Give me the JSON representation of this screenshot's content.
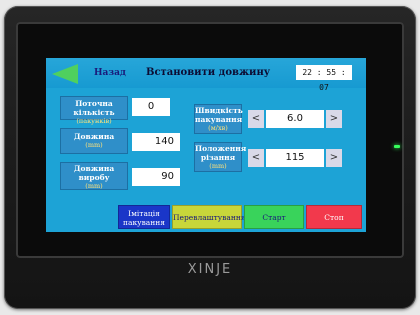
{
  "header": {
    "back_label": "Назад",
    "title": "Встановити довжину",
    "time": "22 : 55 : 07"
  },
  "fields": {
    "current_count": {
      "label": "Поточна кількість",
      "unit": "(пакунків)",
      "value": "0"
    },
    "length": {
      "label": "Довжина",
      "unit": "(mm)",
      "value": "140"
    },
    "product_length": {
      "label": "Довжина виробу",
      "unit": "(mm)",
      "value": "90"
    },
    "packing_speed": {
      "label": "Швидкість пакування",
      "unit": "(м/хв)",
      "value": "6.0",
      "dec": "<",
      "inc": ">"
    },
    "cut_position": {
      "label": "Положення різання",
      "unit": "(mm)",
      "value": "115",
      "dec": "<",
      "inc": ">"
    }
  },
  "buttons": {
    "simulate": {
      "label": "Імітація пакування",
      "color": "#1a36c8"
    },
    "reset": {
      "label": "Перевлаштування",
      "color": "#c8d63a"
    },
    "start": {
      "label": "Старт",
      "color": "#39d35b"
    },
    "stop": {
      "label": "Стоп",
      "color": "#f2394c"
    }
  },
  "device": {
    "brand": "XINJE",
    "screen_color": "#1da3d6",
    "led_color": "#36ff5b"
  }
}
